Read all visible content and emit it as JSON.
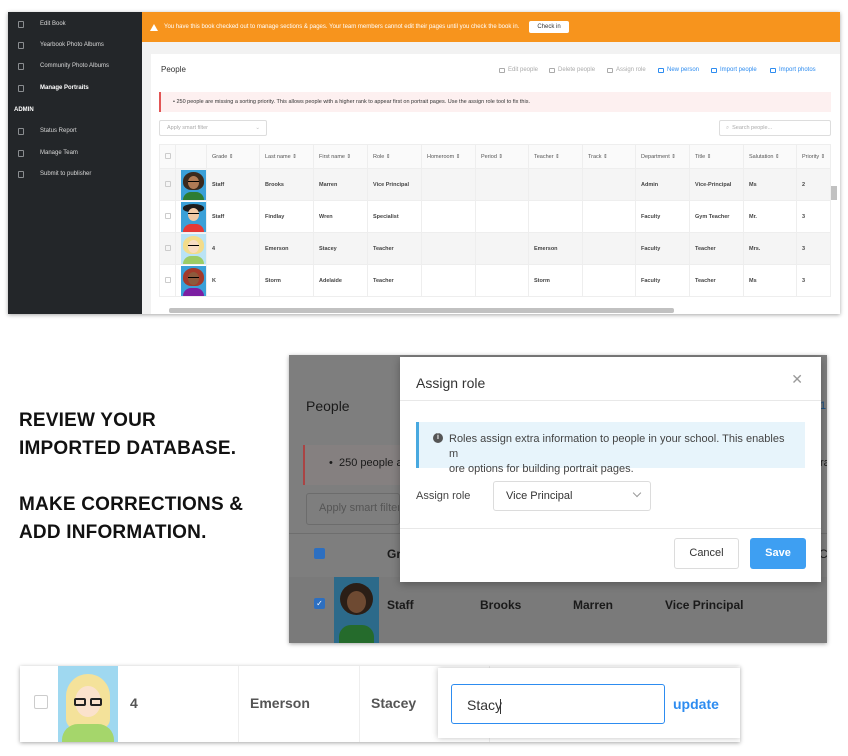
{
  "sidebar": {
    "items": [
      {
        "label": "Edit Book",
        "icon": "book-icon"
      },
      {
        "label": "Yearbook Photo Albums",
        "icon": "album-icon"
      },
      {
        "label": "Community Photo Albums",
        "icon": "share-icon"
      },
      {
        "label": "Manage Portraits",
        "icon": "portrait-icon",
        "active": true
      }
    ],
    "admin_heading": "ADMIN",
    "admin_items": [
      {
        "label": "Status Report",
        "icon": "report-icon"
      },
      {
        "label": "Manage Team",
        "icon": "team-icon"
      },
      {
        "label": "Submit to publisher",
        "icon": "upload-icon"
      }
    ]
  },
  "banner": {
    "text": "You have this book checked out to manage sections & pages. Your team members cannot edit their pages until you check the book in.",
    "button": "Check in",
    "color": "#f7941d"
  },
  "people_panel": {
    "title": "People",
    "toolbar": [
      "Edit people",
      "Delete people",
      "Assign role",
      "New person",
      "Import people",
      "Import photos"
    ],
    "alert": "250 people are missing a sorting priority. This allows people with a higher rank to appear first on portrait pages. Use the assign role tool to fix this.",
    "smart_filter_placeholder": "Apply smart filter",
    "search_placeholder": "Search people...",
    "columns": [
      "Grade",
      "Last name",
      "First name",
      "Role",
      "Homeroom",
      "Period",
      "Teacher",
      "Track",
      "Department",
      "Title",
      "Salutation",
      "Priority"
    ],
    "rows": [
      [
        "Staff",
        "Brooks",
        "Marren",
        "Vice Principal",
        "",
        "",
        "",
        "",
        "Admin",
        "Vice-Principal",
        "Ms",
        "2"
      ],
      [
        "Staff",
        "Findlay",
        "Wren",
        "Specialist",
        "",
        "",
        "",
        "",
        "Faculty",
        "Gym Teacher",
        "Mr.",
        "3"
      ],
      [
        "4",
        "Emerson",
        "Stacey",
        "Teacher",
        "",
        "",
        "Emerson",
        "",
        "Faculty",
        "Teacher",
        "Mrs.",
        "3"
      ],
      [
        "K",
        "Storm",
        "Adelaide",
        "Teacher",
        "",
        "",
        "Storm",
        "",
        "Faculty",
        "Teacher",
        "Ms",
        "3"
      ]
    ]
  },
  "headline": {
    "line1": "REVIEW YOUR",
    "line2": "IMPORTED DATABASE.",
    "line3": "MAKE CORRECTIONS &",
    "line4": "ADD INFORMATION."
  },
  "modal_bg": {
    "title": "People",
    "alert_partial": "250 people a",
    "filter_partial": "Apply smart filter",
    "col_partial": "Gr",
    "row": [
      "Staff",
      "Brooks",
      "Marren",
      "Vice Principal"
    ],
    "edge_chars": [
      "1",
      "ra",
      "C"
    ]
  },
  "modal": {
    "title": "Assign role",
    "info": "Roles assign extra information to people in your school. This enables more options for building portrait pages.",
    "info_line1": "Roles assign extra information to people in your school. This enables m",
    "info_line2": "ore options for building portrait pages.",
    "role_label": "Assign role",
    "role_value": "Vice Principal",
    "cancel": "Cancel",
    "save": "Save",
    "accent": "#3e9ff2"
  },
  "inline_edit": {
    "grade": "4",
    "last_name": "Emerson",
    "first_name": "Stacey",
    "input_value": "Stacy",
    "update": "update"
  }
}
